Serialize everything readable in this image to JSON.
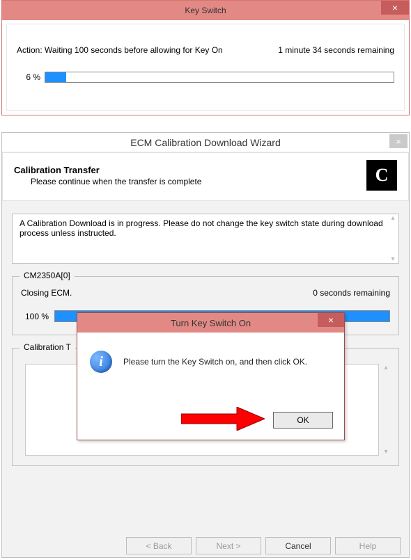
{
  "key_switch_window": {
    "title": "Key Switch",
    "close_glyph": "×",
    "action_label": "Action: Waiting 100 seconds before allowing for Key On",
    "remaining": "1 minute 34 seconds remaining",
    "progress_pct_text": "6 %",
    "progress_pct_value": 6
  },
  "ecm_window": {
    "title": "ECM Calibration Download Wizard",
    "close_glyph": "×",
    "banner_heading": "Calibration Transfer",
    "banner_sub": "Please continue when the transfer is complete",
    "logo_letter": "C",
    "info_message": "A Calibration Download is in progress.  Please do not change the key switch state during download process unless instructed.",
    "device_group_label": "CM2350A[0]",
    "device_status": "Closing ECM.",
    "device_remaining": "0 seconds remaining",
    "device_progress_pct_text": "100 %",
    "device_progress_pct_value": 100,
    "transfer_group_label": "Calibration T",
    "buttons": {
      "back": "< Back",
      "next": "Next >",
      "cancel": "Cancel",
      "help": "Help"
    }
  },
  "modal": {
    "title": "Turn Key Switch On",
    "close_glyph": "×",
    "info_glyph": "i",
    "message": "Please turn the Key Switch on, and then click OK.",
    "ok_label": "OK"
  },
  "glyphs": {
    "up": "▴",
    "down": "▾"
  }
}
